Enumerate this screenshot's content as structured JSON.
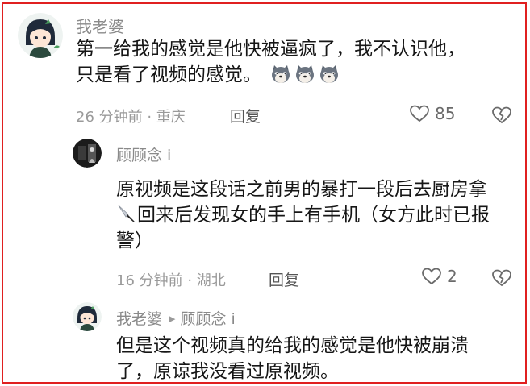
{
  "comments": [
    {
      "username": "我老婆",
      "text": "第一给我的感觉是他快被逼疯了，我不认识他，只是看了视频的感觉。",
      "emoji": [
        "doge-icon",
        "doge-icon",
        "doge-icon"
      ],
      "time_location": "26 分钟前 · 重庆",
      "reply_label": "回复",
      "likes": "85"
    }
  ],
  "replies": [
    {
      "username": "顾顾念 i",
      "text_before_emoji": "原视频是这段话之前男的暴打一段后去厨房拿",
      "emoji": "knife-icon",
      "text_after_emoji": "回来后发现女的手上有手机（女方此时已报警）",
      "time_location": "16 分钟前 · 湖北",
      "reply_label": "回复",
      "likes": "2"
    },
    {
      "username": "我老婆",
      "reply_to": "顾顾念 i",
      "text": "但是这个视频真的给我的感觉是他快被崩溃了，原谅我没看过原视频。"
    }
  ]
}
